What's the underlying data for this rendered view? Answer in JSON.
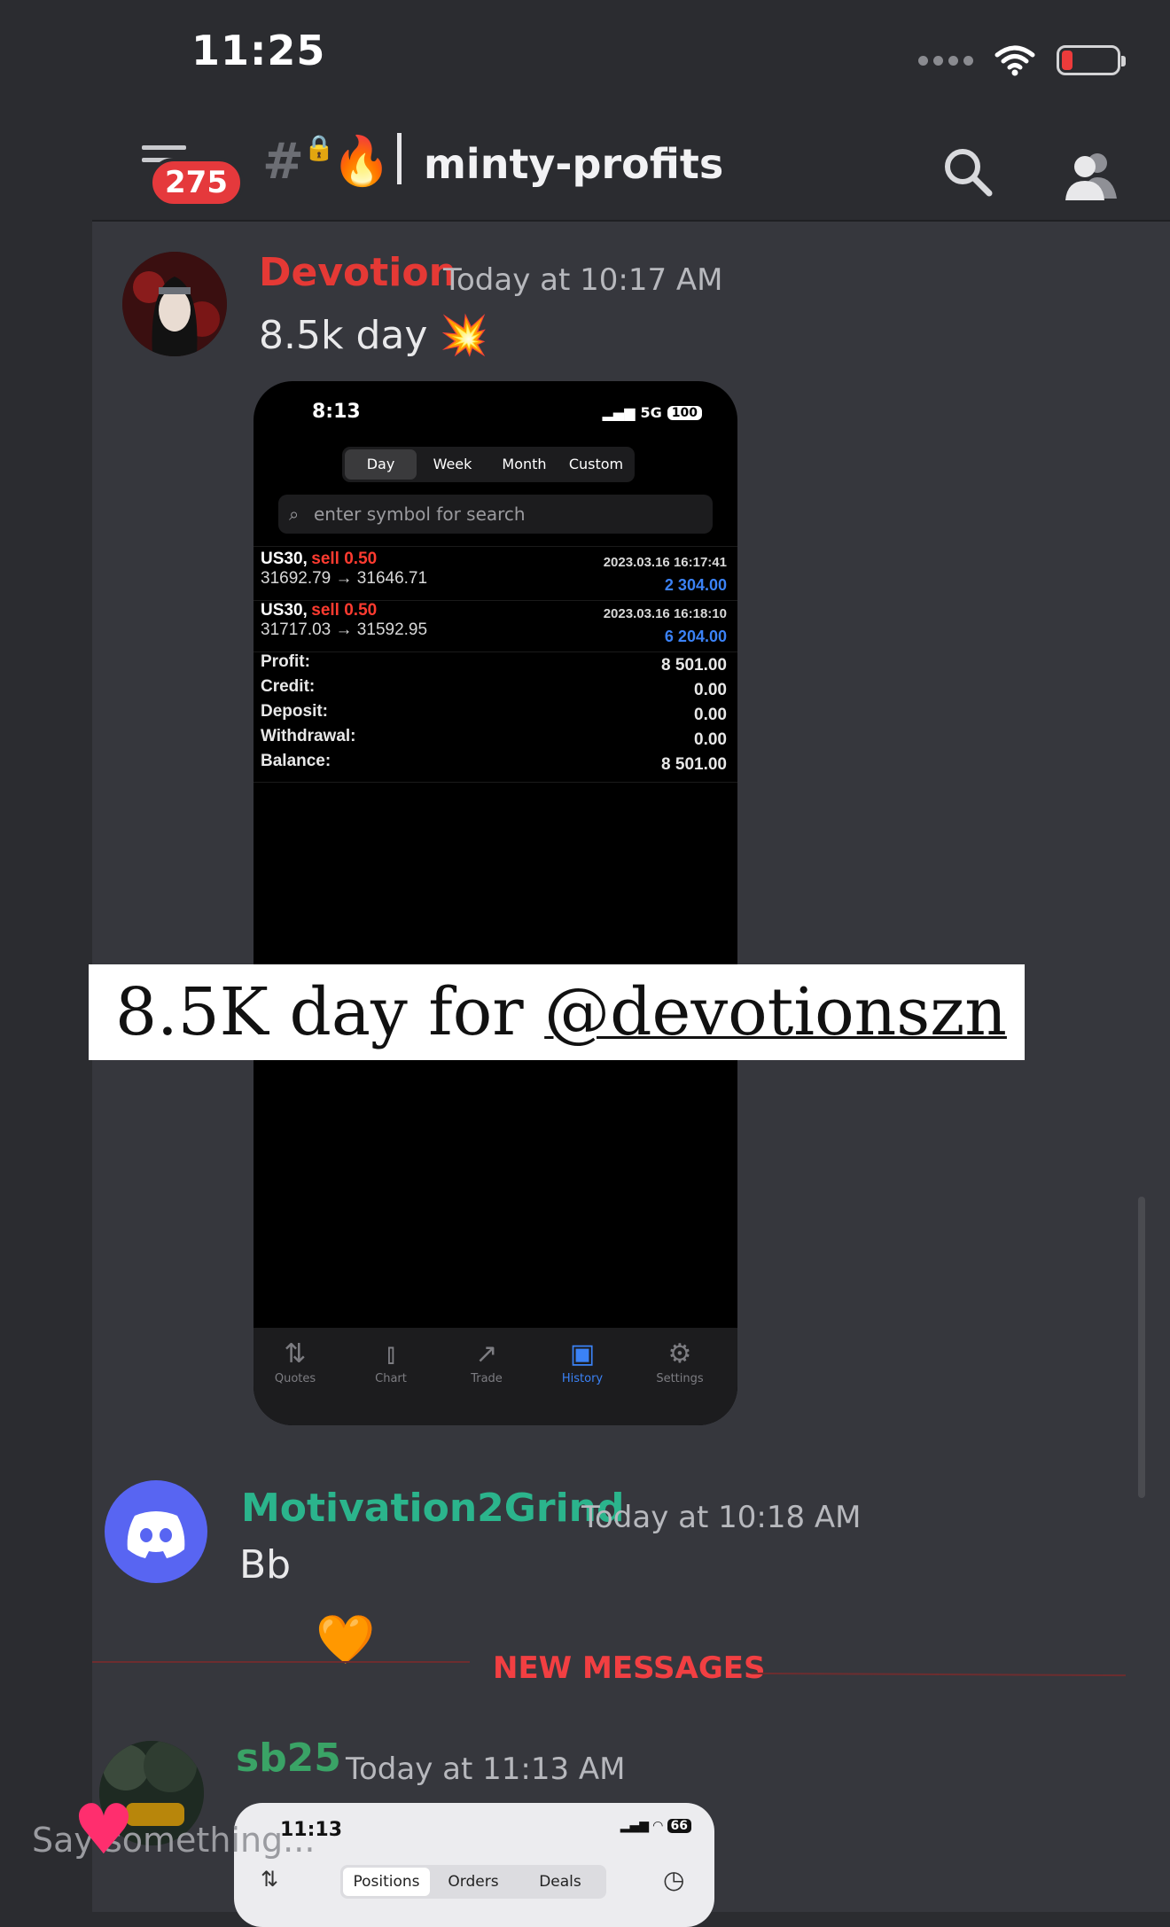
{
  "status_bar": {
    "time": "11:25"
  },
  "header": {
    "unread_badge": "275",
    "channel_prefix": "#",
    "channel_emoji": "🔥",
    "channel_name": "minty-profits"
  },
  "messages": [
    {
      "username": "Devotion",
      "username_color": "#e53935",
      "timestamp": "Today at 10:17 AM",
      "text": "8.5k day",
      "emoji": "💥"
    },
    {
      "username": "Motivation2Grind",
      "username_color": "#2bb48c",
      "timestamp": "Today at 10:18 AM",
      "text": "Bb",
      "reaction": "🧡"
    },
    {
      "username": "sb25",
      "username_color": "#3aa366",
      "timestamp": "Today at 11:13 AM"
    }
  ],
  "divider": {
    "label": "NEW MESSAGES"
  },
  "screenshot": {
    "time": "8:13",
    "network": "5G",
    "battery": "100",
    "tabs": [
      "Day",
      "Week",
      "Month",
      "Custom"
    ],
    "active_tab": "Day",
    "search_placeholder": "enter symbol for search",
    "trades": [
      {
        "symbol": "US30,",
        "side": "sell 0.50",
        "prices": "31692.79 → 31646.71",
        "date": "2023.03.16 16:17:41",
        "profit": "2 304.00"
      },
      {
        "symbol": "US30,",
        "side": "sell 0.50",
        "prices": "31717.03 → 31592.95",
        "date": "2023.03.16 16:18:10",
        "profit": "6 204.00"
      }
    ],
    "summary": [
      {
        "label": "Profit:",
        "value": "8 501.00"
      },
      {
        "label": "Credit:",
        "value": "0.00"
      },
      {
        "label": "Deposit:",
        "value": "0.00"
      },
      {
        "label": "Withdrawal:",
        "value": "0.00"
      },
      {
        "label": "Balance:",
        "value": "8 501.00"
      }
    ],
    "bottom_tabs": [
      "Quotes",
      "Chart",
      "Trade",
      "History",
      "Settings"
    ],
    "active_bottom_tab": "History"
  },
  "caption": {
    "text": "8.5K day for ",
    "handle": "@devotionszn"
  },
  "mini_screenshot": {
    "time": "11:13",
    "battery": "66",
    "tabs": [
      "Positions",
      "Orders",
      "Deals"
    ],
    "active_tab": "Positions"
  },
  "story_input": {
    "placeholder": "Say something..."
  }
}
